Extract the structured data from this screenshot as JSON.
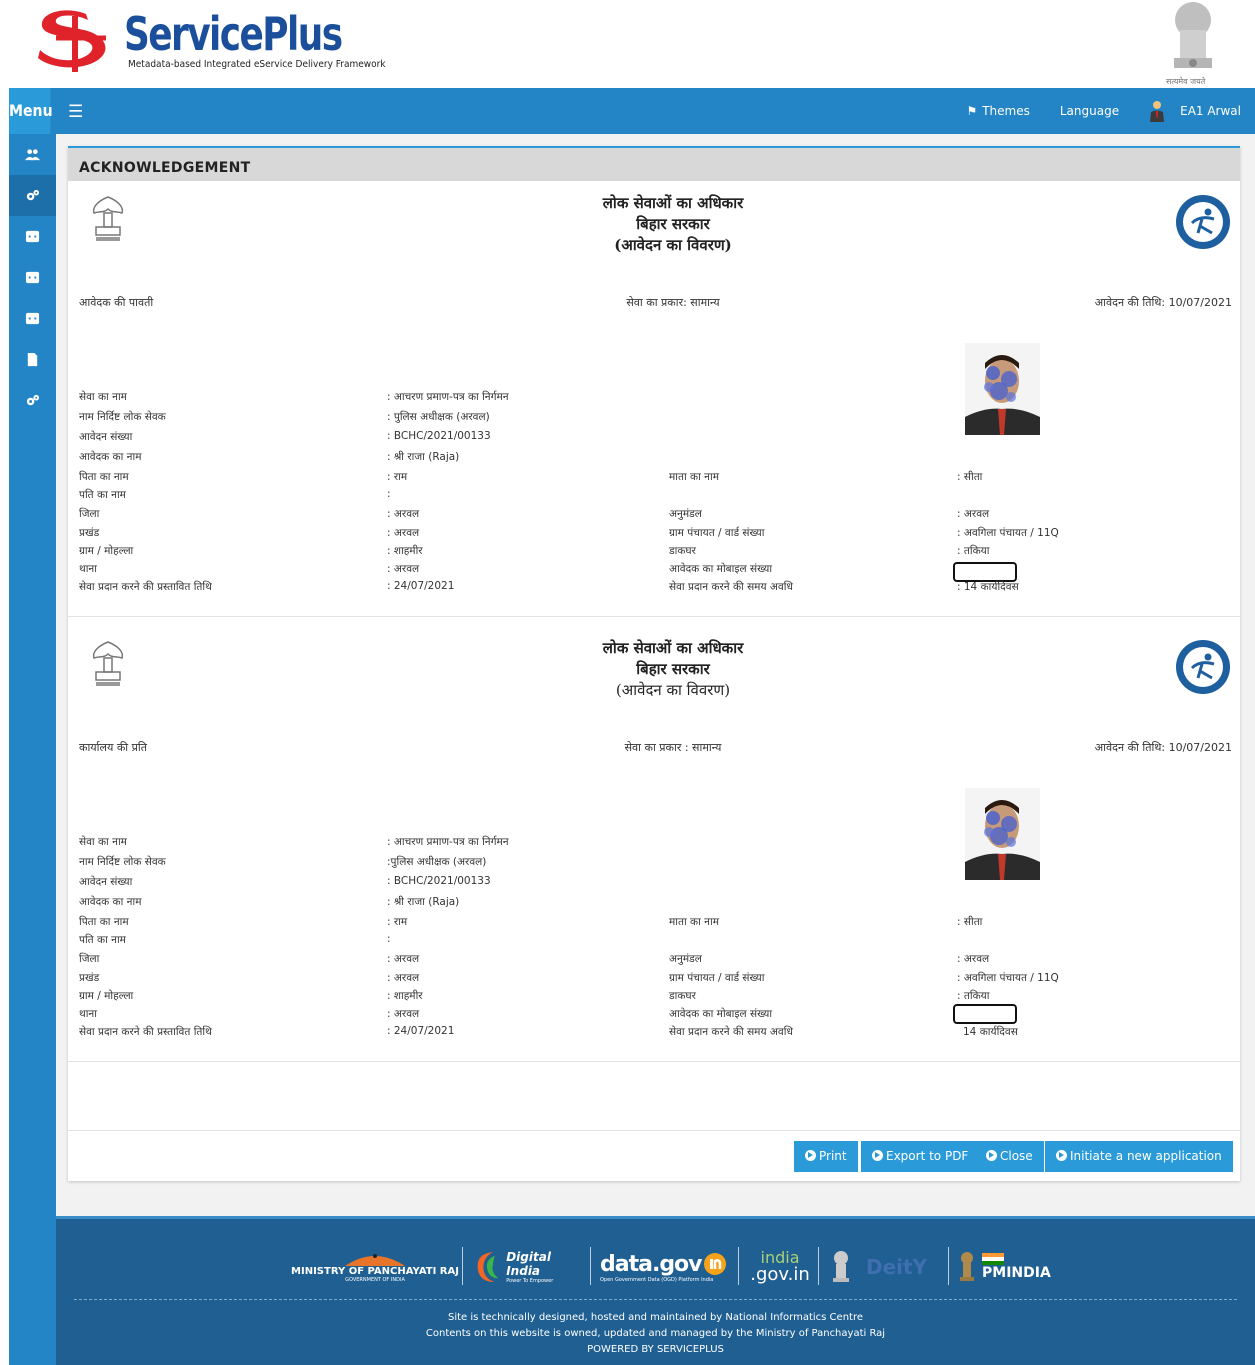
{
  "header": {
    "brand_title": "ServicePlus",
    "brand_subtitle": "Metadata-based Integrated eService Delivery Framework",
    "emblem_caption": "सत्यमेव जयते"
  },
  "navbar": {
    "menu_label": "Menu",
    "themes_label": "Themes",
    "language_label": "Language",
    "user_label": "EA1 Arwal"
  },
  "sidebar": {
    "icons": [
      "users-icon",
      "cogs-icon",
      "list-icon",
      "list-icon",
      "list-icon",
      "document-icon",
      "cogs-icon"
    ]
  },
  "page": {
    "heading": "ACKNOWLEDGEMENT"
  },
  "acks": [
    {
      "title1": "लोक सेवाओं का अधिकार",
      "title2": "बिहार सरकार",
      "title3": "(आवेदन का विवरण)",
      "copy_label": "आवेदक की पावती",
      "service_type": "सेवा का प्रकार: सामान्य",
      "app_date": "आवेदन की तिथि: 10/07/2021",
      "fields": {
        "service_name_label": "सेवा का नाम",
        "service_name_value": ": आचरण प्रमाण-पत्र का निर्गमन",
        "officer_label": "नाम निर्दिष्ट लोक सेवक",
        "officer_value": ": पुलिस अधीक्षक (अरवल)",
        "app_no_label": "आवेदन संख्या",
        "app_no_value": ": BCHC/2021/00133",
        "applicant_label": "आवेदक का नाम",
        "applicant_value": ": श्री राजा (Raja)",
        "father_label": "पिता का नाम",
        "father_value": ": राम",
        "mother_label": "माता का नाम",
        "mother_value": ": सीता",
        "husband_label": "पति का नाम",
        "husband_value": ":",
        "district_label": "जिला",
        "district_value": ": अरवल",
        "subdiv_label": "अनुमंडल",
        "subdiv_value": ": अरवल",
        "block_label": "प्रखंड",
        "block_value": ": अरवल",
        "panchayat_label": "ग्राम पंचायत / वार्ड संख्या",
        "panchayat_value": ": अवगिला पंचायत / 11Q",
        "village_label": "ग्राम / मोहल्ला",
        "village_value": ": शाहमीर",
        "post_label": "डाकघर",
        "post_value": ": तकिया",
        "thana_label": "थाना",
        "thana_value": ": अरवल",
        "mobile_label": "आवेदक का मोबाइल संख्या",
        "due_date_label": "सेवा प्रदान करने की प्रस्तावित तिथि",
        "due_date_value": ": 24/07/2021",
        "period_label": "सेवा प्रदान करने की समय अवधि",
        "period_value": ": 14 कार्यदिवस"
      }
    },
    {
      "title1": "लोक सेवाओं का अधिकार",
      "title2": "बिहार सरकार",
      "title3": "(आवेदन का विवरण)",
      "copy_label": "कार्यालय की प्रति",
      "service_type": "सेवा का प्रकार : सामान्य",
      "app_date": "आवेदन की तिथि: 10/07/2021",
      "fields": {
        "service_name_label": "सेवा का नाम",
        "service_name_value": ": आचरण प्रमाण-पत्र का निर्गमन",
        "officer_label": "नाम निर्दिष्ट लोक सेवक",
        "officer_value": ":पुलिस अधीक्षक (अरवल)",
        "app_no_label": "आवेदन संख्या",
        "app_no_value": ": BCHC/2021/00133",
        "applicant_label": "आवेदक का नाम",
        "applicant_value": ": श्री राजा (Raja)",
        "father_label": "पिता का नाम",
        "father_value": ": राम",
        "mother_label": "माता का नाम",
        "mother_value": ": सीता",
        "husband_label": "पति का नाम",
        "husband_value": ":",
        "district_label": "जिला",
        "district_value": ": अरवल",
        "subdiv_label": "अनुमंडल",
        "subdiv_value": ": अरवल",
        "block_label": "प्रखंड",
        "block_value": ": अरवल",
        "panchayat_label": "ग्राम पंचायत / वार्ड संख्या",
        "panchayat_value": ": अवगिला पंचायत / 11Q",
        "village_label": "ग्राम / मोहल्ला",
        "village_value": ": शाहमीर",
        "post_label": "डाकघर",
        "post_value": ": तकिया",
        "thana_label": "थाना",
        "thana_value": ": अरवल",
        "mobile_label": "आवेदक का मोबाइल संख्या",
        "due_date_label": "सेवा प्रदान करने की प्रस्तावित तिथि",
        "due_date_value": ": 24/07/2021",
        "period_label": "सेवा प्रदान करने की समय अवधि",
        "period_value": "14 कार्यदिवस"
      }
    }
  ],
  "buttons": {
    "print": "Print",
    "export_pdf": "Export to PDF",
    "close": "Close",
    "new_app": "Initiate a new application"
  },
  "footer": {
    "logos": {
      "panchayati": "MINISTRY OF PANCHAYATI RAJ",
      "panchayati_sub": "GOVERNMENT OF INDIA",
      "digital_india": "Digital India",
      "digital_india_sub": "Power To Empower",
      "datagov": "data.gov",
      "datagov_sub": "Open Government Data (OGD) Platform India",
      "indiagov_top": "india",
      "indiagov_bottom": ".gov.in",
      "deity": "DeitY",
      "pmindia": "PMINDIA"
    },
    "line1": "Site is technically designed, hosted and maintained by National Informatics Centre",
    "line2": "Contents on this website is owned, updated and managed by the Ministry of Panchayati Raj",
    "line3": "POWERED BY SERVICEPLUS"
  },
  "colors": {
    "primary": "#2385c5",
    "button": "#2a9bd8",
    "footer": "#1f5f92",
    "brand": "#1b4f9c",
    "logo_red": "#e0232a"
  }
}
